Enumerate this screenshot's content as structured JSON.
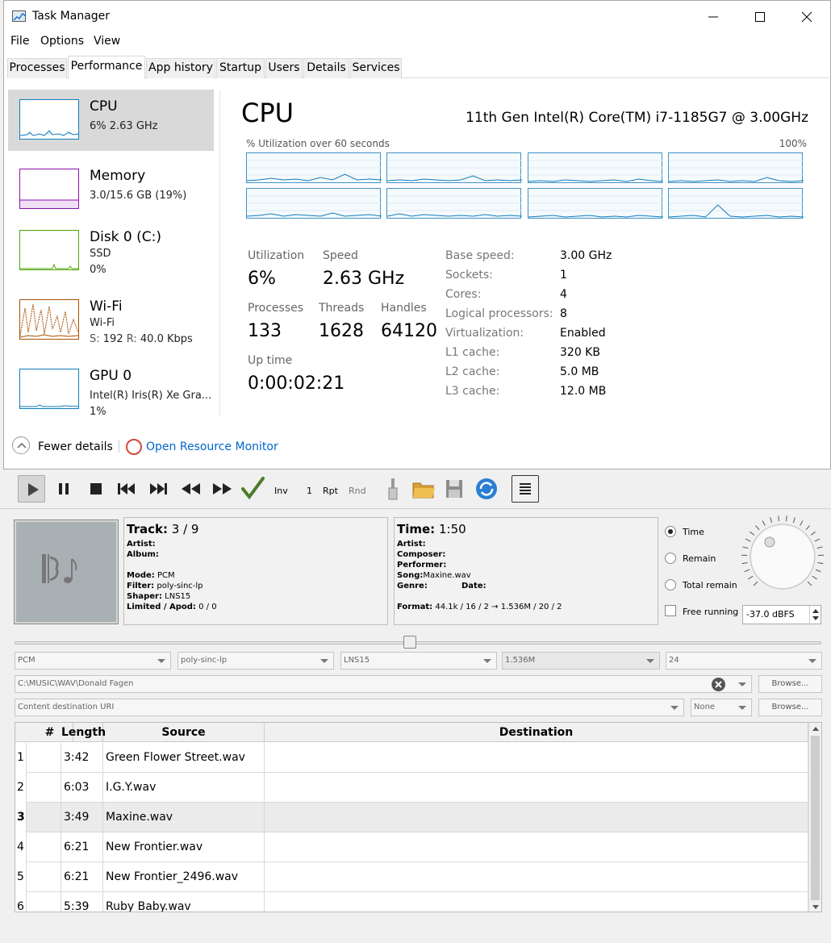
{
  "window": {
    "title": "Task Manager"
  },
  "menu": [
    "File",
    "Options",
    "View"
  ],
  "tabs": [
    "Processes",
    "Performance",
    "App history",
    "Startup",
    "Users",
    "Details",
    "Services"
  ],
  "active_tab": "Performance",
  "sidebar": [
    {
      "name": "CPU",
      "sub1": "6% 2.63 GHz",
      "color": "#117dbb"
    },
    {
      "name": "Memory",
      "sub1": "3.0/15.6 GB (19%)",
      "color": "#8b12ae"
    },
    {
      "name": "Disk 0 (C:)",
      "sub1": "SSD",
      "sub2": "0%",
      "color": "#4da60c"
    },
    {
      "name": "Wi-Fi",
      "sub1": "Wi-Fi",
      "s_label": "S:",
      "s_value": "192",
      "r_label": "R:",
      "r_value": "40.0 Kbps",
      "color": "#a74f01"
    },
    {
      "name": "GPU 0",
      "sub1": "Intel(R) Iris(R) Xe Gra...",
      "sub2": "1%",
      "color": "#117dbb"
    }
  ],
  "cpu": {
    "title": "CPU",
    "model": "11th Gen Intel(R) Core(TM) i7-1185G7 @ 3.00GHz",
    "util_label": "% Utilization over 60 seconds",
    "util_max": "100%",
    "stats": {
      "utilization_label": "Utilization",
      "utilization": "6%",
      "speed_label": "Speed",
      "speed": "2.63 GHz",
      "processes_label": "Processes",
      "processes": "133",
      "threads_label": "Threads",
      "threads": "1628",
      "handles_label": "Handles",
      "handles": "64120",
      "uptime_label": "Up time",
      "uptime": "0:00:02:21"
    },
    "specs": [
      {
        "k": "Base speed:",
        "v": "3.00 GHz"
      },
      {
        "k": "Sockets:",
        "v": "1"
      },
      {
        "k": "Cores:",
        "v": "4"
      },
      {
        "k": "Logical processors:",
        "v": "8"
      },
      {
        "k": "Virtualization:",
        "v": "Enabled"
      },
      {
        "k": "L1 cache:",
        "v": "320 KB"
      },
      {
        "k": "L2 cache:",
        "v": "5.0 MB"
      },
      {
        "k": "L3 cache:",
        "v": "12.0 MB"
      }
    ]
  },
  "footer": {
    "fewer": "Fewer details",
    "resmon": "Open Resource Monitor"
  },
  "player": {
    "toolbar": {
      "inv": "Inv",
      "one": "1",
      "rpt": "Rpt",
      "rnd": "Rnd"
    },
    "track": {
      "track_label": "Track:",
      "track_value": "3 / 9",
      "artist_label": "Artist:",
      "album_label": "Album:",
      "mode_label": "Mode:",
      "mode": "PCM",
      "filter_label": "Filter:",
      "filter": "poly-sinc-lp",
      "shaper_label": "Shaper:",
      "shaper": "LNS15",
      "limited_label": "Limited / Apod:",
      "limited": "0 / 0"
    },
    "time": {
      "time_label": "Time:",
      "time_value": "1:50",
      "artist_label": "Artist:",
      "composer_label": "Composer:",
      "performer_label": "Performer:",
      "song_label": "Song:",
      "song": "Maxine.wav",
      "genre_label": "Genre:",
      "date_label": "Date:",
      "format_label": "Format:",
      "format": "44.1k / 16 / 2 → 1.536M / 20 / 2"
    },
    "radios": {
      "time": "Time",
      "remain": "Remain",
      "total": "Total remain",
      "free": "Free running"
    },
    "volume": "-37.0 dBFS",
    "seek_fraction": 0.49,
    "combos": {
      "mode": "PCM",
      "filter": "poly-sinc-lp",
      "shaper": "LNS15",
      "rate": "1.536M",
      "bits": "24"
    },
    "source_path": "C:\\MUSIC\\WAV\\Donald Fagen",
    "dest_placeholder": "Content destination URI",
    "dest_none": "None",
    "browse": "Browse...",
    "columns": [
      "#",
      "Length",
      "Source",
      "Destination"
    ],
    "rows": [
      {
        "idx": "1",
        "len": "3:42",
        "src": "Green Flower Street.wav",
        "dst": ""
      },
      {
        "idx": "2",
        "len": "6:03",
        "src": "I.G.Y.wav",
        "dst": ""
      },
      {
        "idx": "3",
        "len": "3:49",
        "src": "Maxine.wav",
        "dst": ""
      },
      {
        "idx": "4",
        "len": "6:21",
        "src": "New Frontier.wav",
        "dst": ""
      },
      {
        "idx": "5",
        "len": "6:21",
        "src": "New Frontier_2496.wav",
        "dst": ""
      },
      {
        "idx": "6",
        "len": "5:39",
        "src": "Ruby Baby.wav",
        "dst": ""
      }
    ]
  }
}
